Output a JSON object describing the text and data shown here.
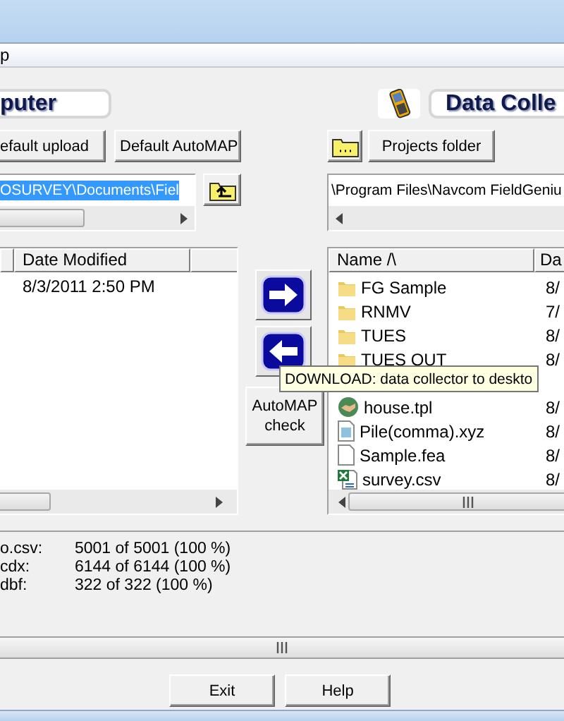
{
  "menu": [
    "p"
  ],
  "left": {
    "header": "puter",
    "buttons": [
      "efault upload",
      "Default AutoMAP"
    ],
    "path": "OSURVEY\\Documents\\Fiel",
    "columns": [
      "Date Modified"
    ],
    "rows": [
      {
        "date": "8/3/2011 2:50 PM"
      }
    ]
  },
  "middle": {
    "check_button": "AutoMAP check"
  },
  "right": {
    "header": "Data Colle",
    "buttons": [
      "Projects folder"
    ],
    "path": "\\Program Files\\Navcom FieldGeniu",
    "columns": [
      "Name /\\",
      "Da"
    ],
    "rows": [
      {
        "name": "FG Sample",
        "kind": "folder",
        "date": "8/"
      },
      {
        "name": "RNMV",
        "kind": "folder",
        "date": "7/"
      },
      {
        "name": "TUES",
        "kind": "folder",
        "date": "8/"
      },
      {
        "name": "TUES OUT",
        "kind": "folder",
        "date": "8/"
      },
      {
        "name": "",
        "kind": "hidden",
        "date": ""
      },
      {
        "name": "house.tpl",
        "kind": "template",
        "date": "8/"
      },
      {
        "name": "Pile(comma).xyz",
        "kind": "xyz",
        "date": "8/"
      },
      {
        "name": "Sample.fea",
        "kind": "document",
        "date": "8/"
      },
      {
        "name": "survey.csv",
        "kind": "spreadsheet",
        "date": "8/"
      }
    ]
  },
  "tooltip": "DOWNLOAD: data collector to deskto",
  "status": [
    {
      "label": "o.csv:",
      "value": "5001 of 5001 (100 %)"
    },
    {
      "label": "cdx:",
      "value": "6144 of 6144 (100 %)"
    },
    {
      "label": "dbf:",
      "value": "322 of 322 (100 %)"
    }
  ],
  "footer_buttons": [
    "Exit",
    "Help"
  ]
}
